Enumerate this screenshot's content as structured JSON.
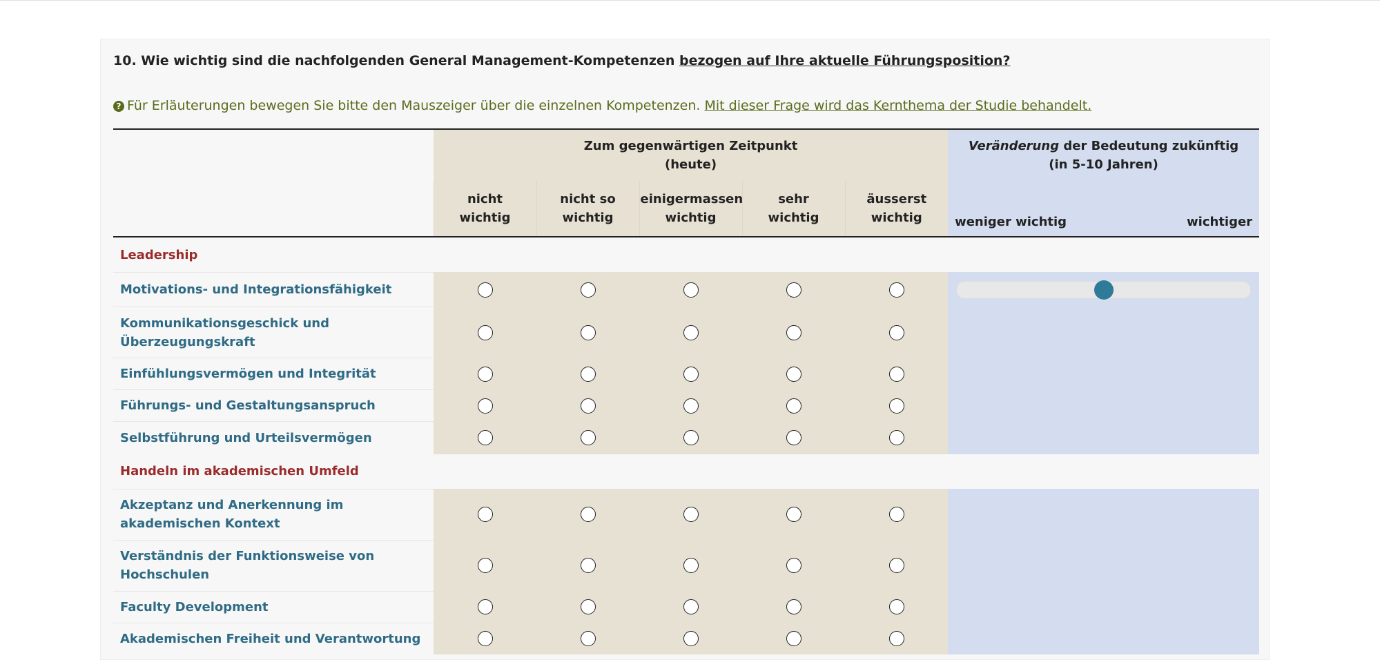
{
  "question": {
    "text": "10. Wie wichtig sind die nachfolgenden General Management-Kompetenzen ",
    "emphasis": "bezogen auf Ihre aktuelle Führungsposition?"
  },
  "hint": {
    "text": "Für Erläuterungen bewegen Sie bitte den Mauszeiger über die einzelnen Kompetenzen. ",
    "link": "Mit dieser Frage wird das Kernthema der Studie behandelt."
  },
  "header": {
    "current_line1": "Zum gegenwärtigen Zeitpunkt",
    "current_line2": "(heute)",
    "future_italic": "Veränderung",
    "future_rest": " der Bedeutung zukünftig",
    "future_line2": "(in 5-10 Jahren)",
    "options": [
      {
        "l1": "nicht",
        "l2": "wichtig"
      },
      {
        "l1": "nicht so",
        "l2": "wichtig"
      },
      {
        "l1": "einigermassen",
        "l2": "wichtig"
      },
      {
        "l1": "sehr",
        "l2": "wichtig"
      },
      {
        "l1": "äusserst",
        "l2": "wichtig"
      }
    ],
    "scale_left": "weniger wichtig",
    "scale_right": "wichtiger"
  },
  "sections": [
    {
      "title": "Leadership",
      "items": [
        {
          "label": "Motivations- und Integrationsfähigkeit",
          "slider": true,
          "slider_value": 0.5
        },
        {
          "label": "Kommunikationsgeschick und Überzeugungskraft"
        },
        {
          "label": "Einfühlungsvermögen und Integrität"
        },
        {
          "label": "Führungs- und Gestaltungsanspruch"
        },
        {
          "label": "Selbstführung und Urteilsvermögen"
        }
      ]
    },
    {
      "title": "Handeln im akademischen Umfeld",
      "items": [
        {
          "label": "Akzeptanz und Anerkennung im akademischen Kontext"
        },
        {
          "label": "Verständnis der Funktionsweise von Hochschulen"
        },
        {
          "label": "Faculty Development"
        },
        {
          "label": "Akademischen Freiheit und Verantwortung"
        }
      ]
    }
  ]
}
